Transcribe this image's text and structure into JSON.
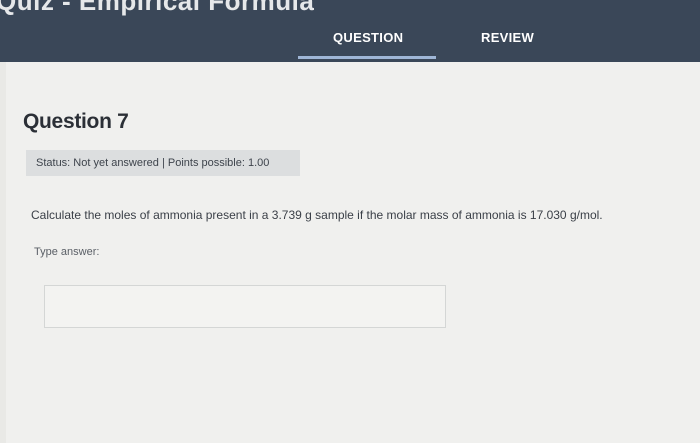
{
  "header": {
    "app_title": "Quiz - Empirical Formula",
    "tabs": [
      {
        "label": "QUESTION",
        "active": true
      },
      {
        "label": "REVIEW",
        "active": false
      }
    ]
  },
  "question": {
    "title": "Question 7",
    "status": "Status: Not yet answered | Points possible: 1.00",
    "prompt": "Calculate the moles of ammonia present in a 3.739 g sample if the molar mass of ammonia is 17.030 g/mol.",
    "answer_label": "Type answer:",
    "answer_value": ""
  },
  "colors": {
    "header_bg": "#3a4758",
    "tab_indicator": "#9fb6d6",
    "content_bg": "#f0f0ee",
    "status_bg": "#dcdedf"
  }
}
